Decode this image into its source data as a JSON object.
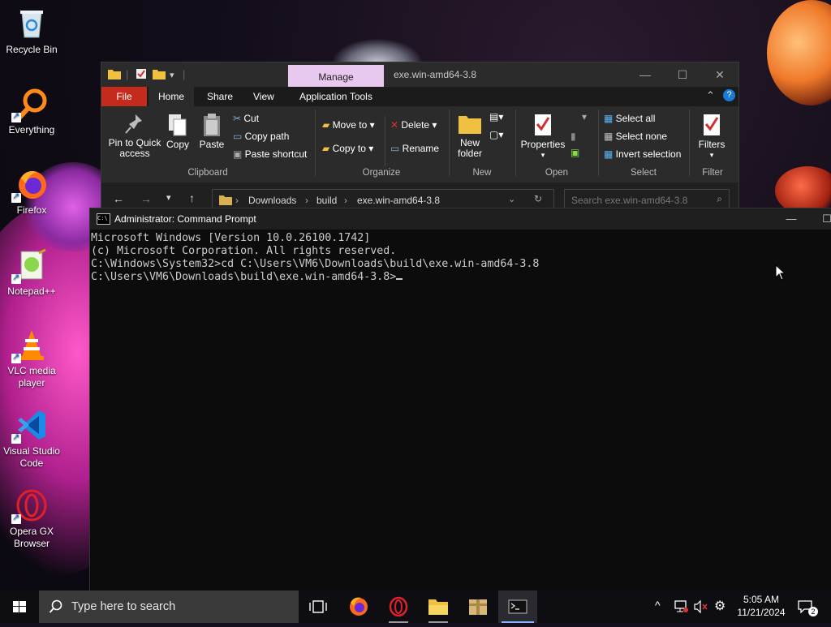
{
  "desktop": {
    "icons": [
      {
        "label": "Recycle Bin"
      },
      {
        "label": "Everything"
      },
      {
        "label": "Firefox"
      },
      {
        "label": "Notepad++"
      },
      {
        "label": "VLC media player"
      },
      {
        "label": "Visual Studio Code"
      },
      {
        "label": "Opera GX Browser"
      }
    ]
  },
  "explorer": {
    "contextual_tab": "Manage",
    "title": "exe.win-amd64-3.8",
    "tabs": {
      "file": "File",
      "home": "Home",
      "share": "Share",
      "view": "View",
      "app_tools": "Application Tools"
    },
    "ribbon": {
      "pin": "Pin to Quick access",
      "copy": "Copy",
      "paste": "Paste",
      "cut": "Cut",
      "copy_path": "Copy path",
      "paste_shortcut": "Paste shortcut",
      "move_to": "Move to",
      "copy_to": "Copy to",
      "delete": "Delete",
      "rename": "Rename",
      "new_folder": "New folder",
      "properties": "Properties",
      "select_all": "Select all",
      "select_none": "Select none",
      "invert_selection": "Invert selection",
      "filters": "Filters"
    },
    "groups": {
      "clipboard": "Clipboard",
      "organize": "Organize",
      "new": "New",
      "open": "Open",
      "select": "Select",
      "filter": "Filter"
    },
    "address": {
      "crumbs": [
        "Downloads",
        "build",
        "exe.win-amd64-3.8"
      ]
    },
    "search_placeholder": "Search exe.win-amd64-3.8"
  },
  "cmd": {
    "title": "Administrator: Command Prompt",
    "lines": [
      "Microsoft Windows [Version 10.0.26100.1742]",
      "(c) Microsoft Corporation. All rights reserved.",
      "",
      "C:\\Windows\\System32>cd C:\\Users\\VM6\\Downloads\\build\\exe.win-amd64-3.8",
      ""
    ],
    "prompt": "C:\\Users\\VM6\\Downloads\\build\\exe.win-amd64-3.8>"
  },
  "taskbar": {
    "search_placeholder": "Type here to search",
    "time": "5:05 AM",
    "date": "11/21/2024",
    "notification_count": "2"
  },
  "colors": {
    "file_tab": "#c42b1c",
    "manage_tab": "#e8c8ee",
    "console_bg": "#0c0c0c",
    "console_fg": "#cccccc",
    "accent": "#88b4ff"
  }
}
